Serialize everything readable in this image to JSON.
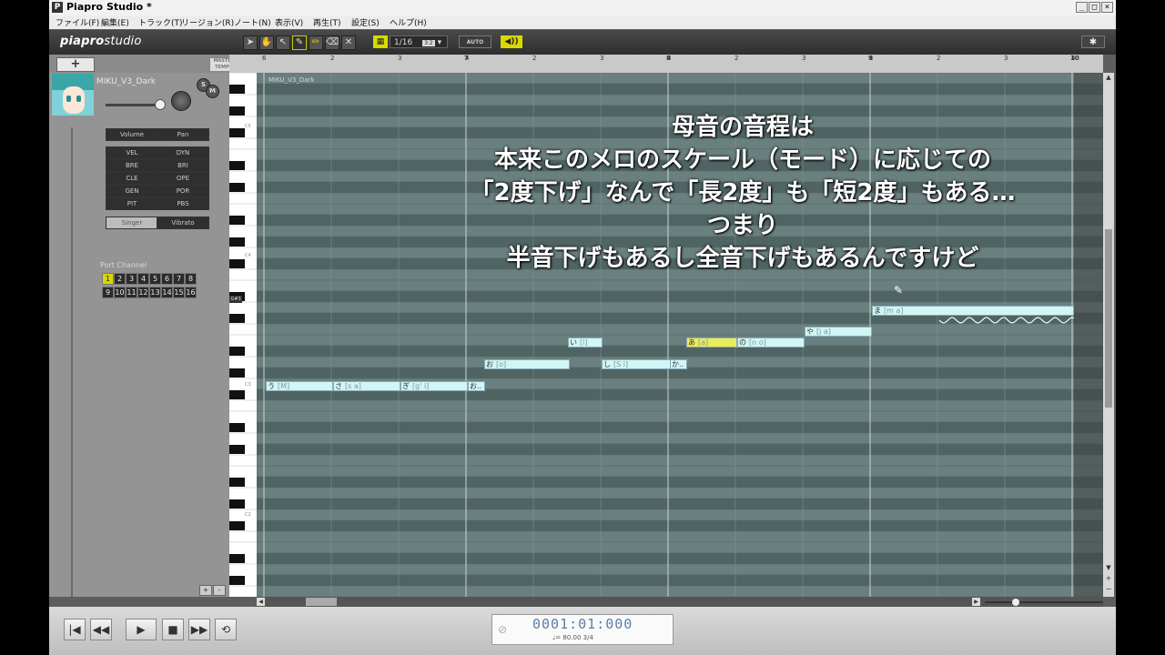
{
  "window": {
    "title": "Piapro Studio *",
    "controls": [
      "_",
      "□",
      "×"
    ]
  },
  "menu": [
    "ファイル(F)",
    "編集(E)",
    "トラック(T)",
    "リージョン(R)",
    "ノート(N)",
    "表示(V)",
    "再生(T)",
    "設定(S)",
    "ヘルプ(H)"
  ],
  "toolbar": {
    "logo_main": "piapro",
    "logo_sub": "studio",
    "quantize": "1/16",
    "quantize_badge": "3:2",
    "auto": "AUTO",
    "settings_icon": "gear-icon"
  },
  "left": {
    "add_track": "+",
    "master_tempo_line1": "MASTER",
    "master_tempo_line2": "TEMPO",
    "track_name": "MIKU_V3_Dark",
    "solo": "S",
    "mute": "M",
    "tabs": [
      "Volume",
      "Pan"
    ],
    "params": [
      "VEL",
      "DYN",
      "BRE",
      "BRI",
      "CLE",
      "OPE",
      "GEN",
      "POR",
      "PIT",
      "PBS"
    ],
    "lower_tabs": [
      "Singer",
      "Vibrato"
    ],
    "port_channel_label": "Port Channel",
    "channels": [
      "1",
      "2",
      "3",
      "4",
      "5",
      "6",
      "7",
      "8",
      "9",
      "10",
      "11",
      "12",
      "13",
      "14",
      "15",
      "16"
    ],
    "selected_channel": "1",
    "small_plus": "+",
    "small_minus": "-"
  },
  "ruler": {
    "bar_labels": [
      "6",
      "2",
      "3",
      "4",
      "7",
      "2",
      "3",
      "4",
      "8",
      "2",
      "3",
      "4",
      "9",
      "2",
      "3",
      "4",
      "10"
    ]
  },
  "keys": {
    "c_labels": [
      "C5",
      "C4",
      "G#3",
      "C3",
      "C2"
    ]
  },
  "region_label": "MIKU_V3_Dark",
  "notes": [
    {
      "lyric": "う",
      "phoneme": "[M]",
      "highlight": false
    },
    {
      "lyric": "さ",
      "phoneme": "[s a]",
      "highlight": false
    },
    {
      "lyric": "ぎ",
      "phoneme": "[g' i]",
      "highlight": false
    },
    {
      "lyric": "お..",
      "phoneme": "",
      "highlight": false
    },
    {
      "lyric": "お",
      "phoneme": "[o]",
      "highlight": false
    },
    {
      "lyric": "い",
      "phoneme": "[i]",
      "highlight": false
    },
    {
      "lyric": "し",
      "phoneme": "[S i]",
      "highlight": false
    },
    {
      "lyric": "か..",
      "phoneme": "",
      "highlight": false
    },
    {
      "lyric": "あ",
      "phoneme": "[a]",
      "highlight": true
    },
    {
      "lyric": "の",
      "phoneme": "[n o]",
      "highlight": false
    },
    {
      "lyric": "や",
      "phoneme": "[j a]",
      "highlight": false
    },
    {
      "lyric": "ま",
      "phoneme": "[m a]",
      "highlight": false
    }
  ],
  "caption": [
    "母音の音程は",
    "本来このメロのスケール（モード）に応じての",
    "「2度下げ」なんで「長2度」も「短2度」もある…",
    "つまり",
    "半音下げもあるし全音下げもあるんですけど"
  ],
  "transport": {
    "buttons": [
      "|◀",
      "◀◀",
      "▶",
      "■",
      "▶▶",
      "loop"
    ],
    "time": "0001:01:000",
    "status": "♩= 80.00  3/4"
  },
  "colors": {
    "accent": "#d9d900",
    "note_fill": "#d2f5f5",
    "note_selected": "#ecec57",
    "grid_bg": "#5e7473"
  }
}
